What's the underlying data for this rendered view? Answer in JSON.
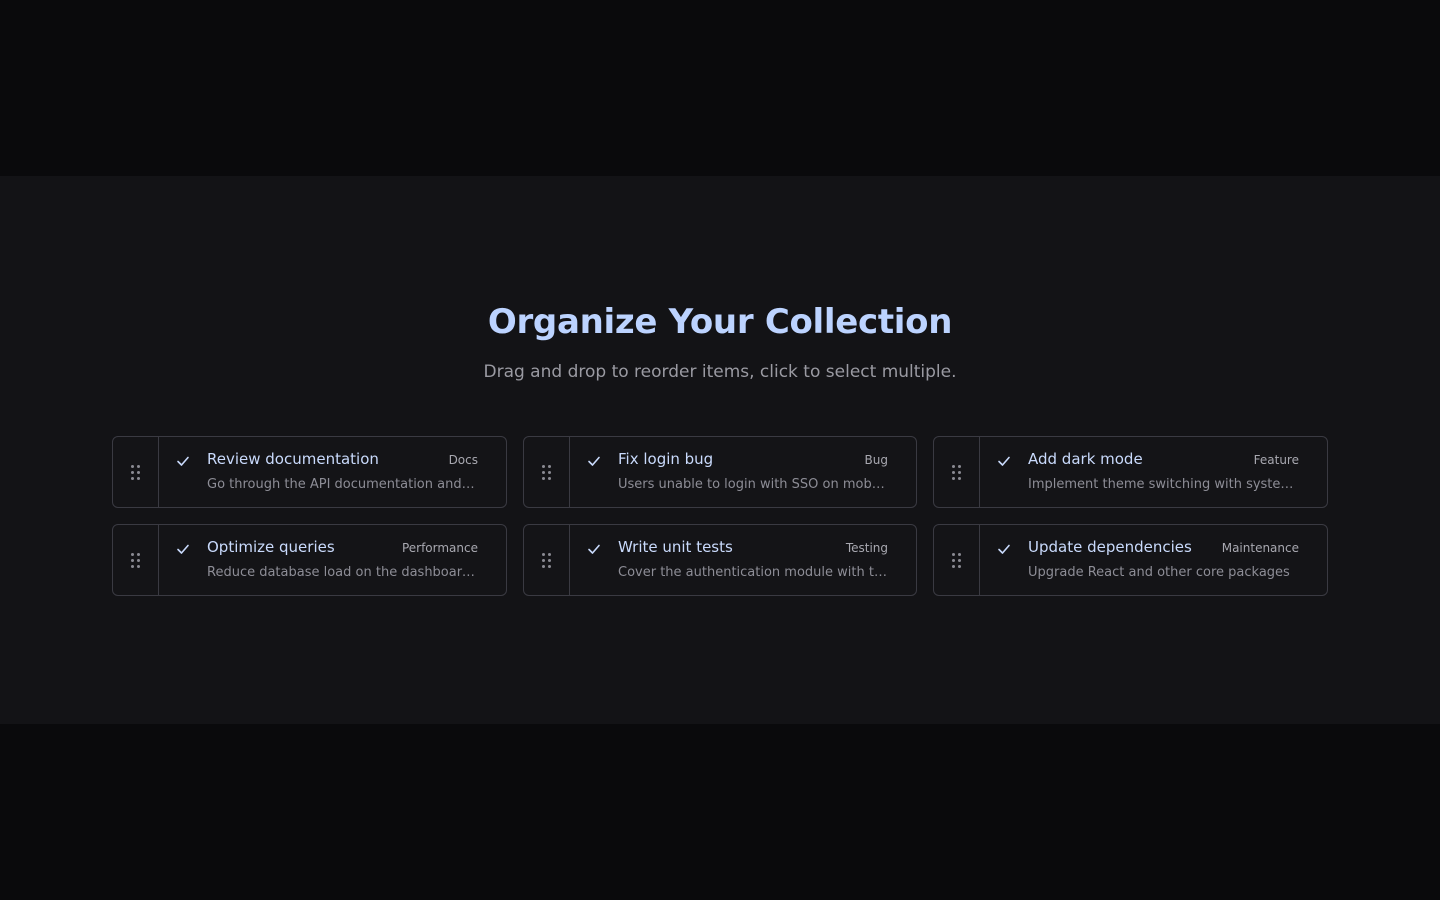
{
  "header": {
    "title": "Organize Your Collection",
    "subtitle": "Drag and drop to reorder items, click to select multiple."
  },
  "colors": {
    "accent": "#bcd3ff",
    "border": "#3a3a42",
    "section_bg": "#131316",
    "page_bg": "#0a0a0c"
  },
  "items": [
    {
      "title": "Review documentation",
      "tag": "Docs",
      "description": "Go through the API documentation and update examples",
      "selected": true
    },
    {
      "title": "Fix login bug",
      "tag": "Bug",
      "description": "Users unable to login with SSO on mobile devices",
      "selected": true
    },
    {
      "title": "Add dark mode",
      "tag": "Feature",
      "description": "Implement theme switching with system preference",
      "selected": true
    },
    {
      "title": "Optimize queries",
      "tag": "Performance",
      "description": "Reduce database load on the dashboard page",
      "selected": true
    },
    {
      "title": "Write unit tests",
      "tag": "Testing",
      "description": "Cover the authentication module with tests",
      "selected": true
    },
    {
      "title": "Update dependencies",
      "tag": "Maintenance",
      "description": "Upgrade React and other core packages",
      "selected": true
    }
  ]
}
